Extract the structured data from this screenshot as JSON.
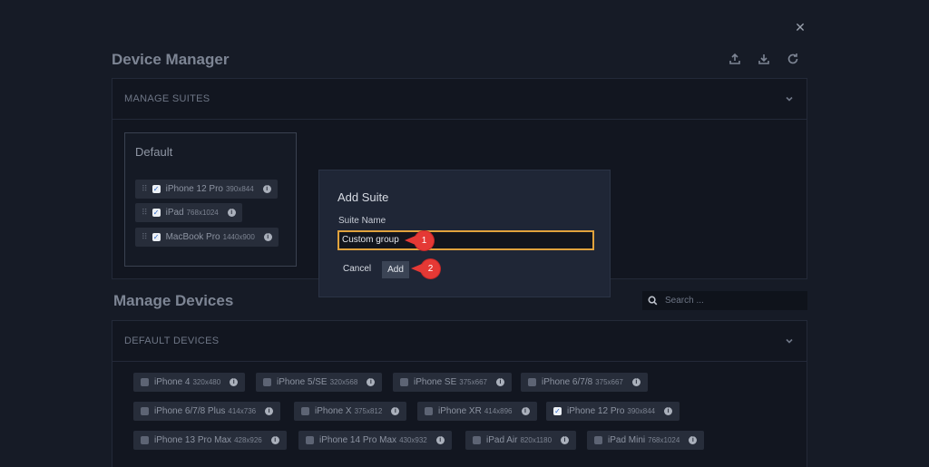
{
  "header": {
    "title": "Device Manager",
    "icons": [
      "upload-icon",
      "download-icon",
      "refresh-icon",
      "close-icon"
    ]
  },
  "suites_panel": {
    "label": "MANAGE SUITES",
    "suite": {
      "name": "Default",
      "devices": [
        {
          "name": "iPhone 12 Pro",
          "res": "390x844",
          "checked": true
        },
        {
          "name": "iPad",
          "res": "768x1024",
          "checked": true
        },
        {
          "name": "MacBook Pro",
          "res": "1440x900",
          "checked": true
        }
      ]
    }
  },
  "devices_section": {
    "title": "Manage Devices",
    "search_placeholder": "Search ...",
    "panel_label": "DEFAULT DEVICES",
    "devices": [
      {
        "name": "iPhone 4",
        "res": "320x480",
        "checked": false
      },
      {
        "name": "iPhone 5/SE",
        "res": "320x568",
        "checked": false
      },
      {
        "name": "iPhone SE",
        "res": "375x667",
        "checked": false
      },
      {
        "name": "iPhone 6/7/8",
        "res": "375x667",
        "checked": false
      },
      {
        "name": "iPhone 6/7/8 Plus",
        "res": "414x736",
        "checked": false
      },
      {
        "name": "iPhone X",
        "res": "375x812",
        "checked": false
      },
      {
        "name": "iPhone XR",
        "res": "414x896",
        "checked": false
      },
      {
        "name": "iPhone 12 Pro",
        "res": "390x844",
        "checked": true
      },
      {
        "name": "iPhone 13 Pro Max",
        "res": "428x926",
        "checked": false
      },
      {
        "name": "iPhone 14 Pro Max",
        "res": "430x932",
        "checked": false
      },
      {
        "name": "iPad Air",
        "res": "820x1180",
        "checked": false
      },
      {
        "name": "iPad Mini",
        "res": "768x1024",
        "checked": false
      }
    ]
  },
  "modal": {
    "title": "Add Suite",
    "field_label": "Suite Name",
    "field_value": "Custom group",
    "cancel_label": "Cancel",
    "add_label": "Add",
    "callouts": [
      "1",
      "2"
    ]
  },
  "colors": {
    "background": "#161b26",
    "modal": "#1f2636",
    "field_focus": "#e0a23d",
    "callout": "#e53935",
    "check": "#2b66c9"
  }
}
